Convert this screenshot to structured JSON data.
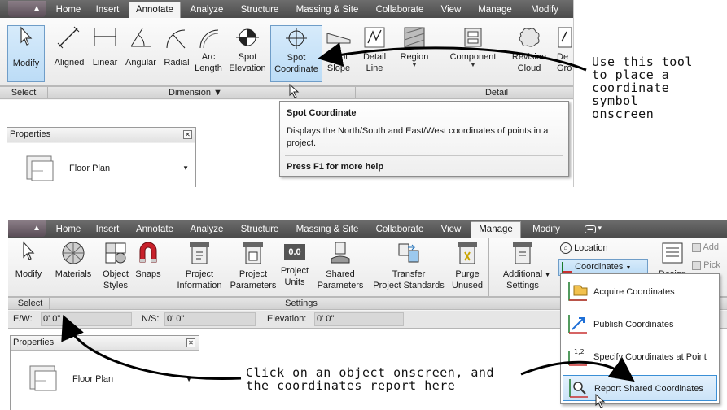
{
  "top": {
    "tabs": [
      "Home",
      "Insert",
      "Annotate",
      "Analyze",
      "Structure",
      "Massing & Site",
      "Collaborate",
      "View",
      "Manage",
      "Modify"
    ],
    "active_tab": "Annotate",
    "tools": {
      "modify": "Modify",
      "aligned": "Aligned",
      "linear": "Linear",
      "angular": "Angular",
      "radial": "Radial",
      "arc_length_1": "Arc",
      "arc_length_2": "Length",
      "spot_elevation_1": "Spot",
      "spot_elevation_2": "Elevation",
      "spot_coordinate_1": "Spot",
      "spot_coordinate_2": "Coordinate",
      "spot_slope_1": "Spot",
      "spot_slope_2": "Slope",
      "detail_line_1": "Detail",
      "detail_line_2": "Line",
      "region": "Region",
      "component": "Component",
      "revision_cloud_1": "Revision",
      "revision_cloud_2": "Cloud",
      "detail_group_1": "De",
      "detail_group_2": "Gro"
    },
    "panels": {
      "select": "Select",
      "dimension": "Dimension",
      "detail": "Detail"
    },
    "tooltip": {
      "title": "Spot Coordinate",
      "description": "Displays the North/South and East/West coordinates of points in a project.",
      "help": "Press F1 for more help"
    },
    "properties": {
      "title": "Properties",
      "type": "Floor Plan"
    },
    "callout": [
      "Use this tool",
      "to place a",
      "coordinate",
      "symbol",
      "onscreen"
    ]
  },
  "bottom": {
    "tabs": [
      "Home",
      "Insert",
      "Annotate",
      "Analyze",
      "Structure",
      "Massing & Site",
      "Collaborate",
      "View",
      "Manage",
      "Modify"
    ],
    "active_tab": "Manage",
    "tools": {
      "modify": "Modify",
      "materials": "Materials",
      "object_styles_1": "Object",
      "object_styles_2": "Styles",
      "snaps": "Snaps",
      "project_information_1": "Project",
      "project_information_2": "Information",
      "project_parameters_1": "Project",
      "project_parameters_2": "Parameters",
      "project_units_1": "Project",
      "project_units_2": "Units",
      "shared_parameters_1": "Shared",
      "shared_parameters_2": "Parameters",
      "transfer_standards_1": "Transfer",
      "transfer_standards_2": "Project Standards",
      "purge_unused_1": "Purge",
      "purge_unused_2": "Unused",
      "additional_settings_1": "Additional",
      "additional_settings_2": "Settings",
      "location": "Location",
      "coordinates": "Coordinates",
      "design": "Design",
      "add": "Add",
      "pick": "Pick",
      "units_glyph": "0.0"
    },
    "panels": {
      "select": "Select",
      "settings": "Settings"
    },
    "options_bar": {
      "ew_label": "E/W:",
      "ew_value": "0'  0\"",
      "ns_label": "N/S:",
      "ns_value": "0'  0\"",
      "elev_label": "Elevation:",
      "elev_value": "0'  0\""
    },
    "menu": [
      "Acquire Coordinates",
      "Publish Coordinates",
      "Specify Coordinates at Point",
      "Report Shared Coordinates"
    ],
    "properties": {
      "title": "Properties",
      "type": "Floor Plan"
    },
    "callout": [
      "Click on an object onscreen, and",
      "the coordinates report here"
    ]
  }
}
